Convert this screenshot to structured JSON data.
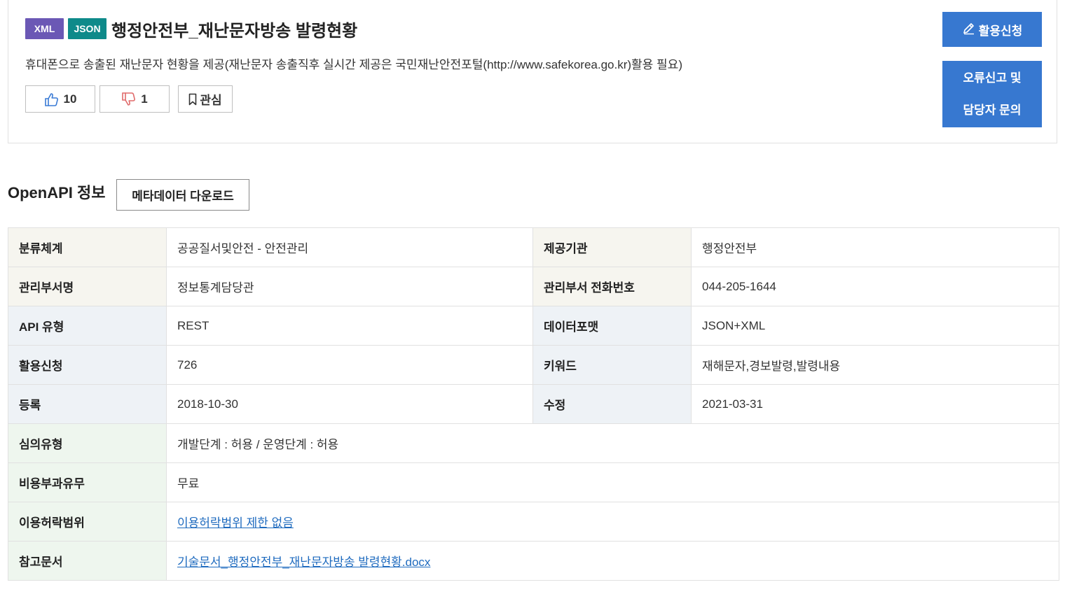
{
  "header": {
    "badges": [
      "XML",
      "JSON"
    ],
    "title": "행정안전부_재난문자방송 발령현황",
    "description": "휴대폰으로 송출된 재난문자 현황을 제공(재난문자 송출직후 실시간 제공은 국민재난안전포털(http://www.safekorea.go.kr)활용 필요)",
    "like_count": "10",
    "dislike_count": "1",
    "favorite_label": "관심",
    "apply_button": "활용신청",
    "report_button_line1": "오류신고 및",
    "report_button_line2": "담당자 문의"
  },
  "section": {
    "title": "OpenAPI 정보",
    "metadata_button": "메타데이터 다운로드"
  },
  "info": {
    "category_label": "분류체계",
    "category": "공공질서및안전 - 안전관리",
    "provider_label": "제공기관",
    "provider": "행정안전부",
    "dept_label": "관리부서명",
    "dept": "정보통계담당관",
    "phone_label": "관리부서 전화번호",
    "phone": "044-205-1644",
    "api_type_label": "API 유형",
    "api_type": "REST",
    "format_label": "데이터포맷",
    "format": "JSON+XML",
    "apply_count_label": "활용신청",
    "apply_count": "726",
    "keyword_label": "키워드",
    "keyword": "재해문자,경보발령,발령내용",
    "registered_label": "등록",
    "registered": "2018-10-30",
    "modified_label": "수정",
    "modified": "2021-03-31",
    "review_label": "심의유형",
    "review": "개발단계 : 허용 / 운영단계 : 허용",
    "fee_label": "비용부과유무",
    "fee": "무료",
    "license_label": "이용허락범위",
    "license": "이용허락범위 제한 없음",
    "reference_label": "참고문서",
    "reference": "기술문서_행정안전부_재난문자방송 발령현황.docx"
  },
  "colors": {
    "xml_badge": "#6b58b5",
    "json_badge": "#0e8a8a",
    "primary_button": "#3778d0",
    "link": "#1f6bbf"
  },
  "icons": [
    "thumbs-up-icon",
    "thumbs-down-icon",
    "bookmark-icon",
    "pencil-icon"
  ]
}
